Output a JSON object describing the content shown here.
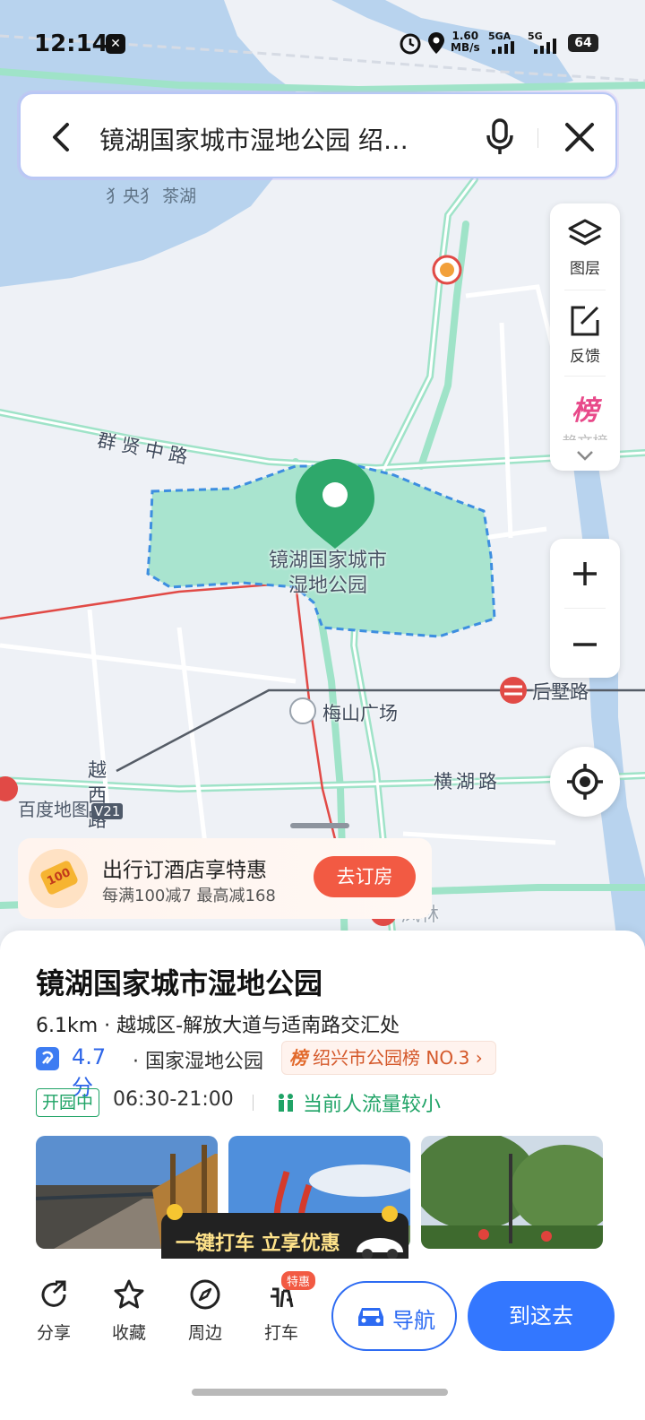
{
  "status_bar": {
    "time": "12:14",
    "speed": "1.60",
    "speed_unit": "MB/s",
    "sig1": "5GA",
    "sig2": "5G",
    "battery": "64"
  },
  "search": {
    "query": "镜湖国家城市湿地公园 绍…"
  },
  "map": {
    "labels": {
      "water": "茶湖",
      "water_partial": "犭央犭",
      "road_qunxian": "群贤中路",
      "park": [
        "镜湖国家城市",
        "湿地公园"
      ],
      "metro_meishan": "梅山广场",
      "metro_houshu": "后墅路",
      "road_henghu": "横湖路",
      "road_yuexi": [
        "越",
        "西",
        "路"
      ],
      "metro_fenglin": "凤林",
      "watermark": "百度地图",
      "watermark_version": "V21"
    }
  },
  "tools": {
    "layers": "图层",
    "feedback": "反馈",
    "rank_label": "榜",
    "rank_text": "趋文榜"
  },
  "promo": {
    "title": "出行订酒店享特惠",
    "subtitle": "每满100减7   最高减168",
    "button": "去订房",
    "icon_text": "100"
  },
  "place": {
    "name": "镜湖国家城市湿地公园",
    "address": "6.1km · 越城区-解放大道与适南路交汇处",
    "rating": "4.7分",
    "type": "· 国家湿地公园",
    "rank_prefix": "榜",
    "rank": "绍兴市公园榜 NO.3 ›",
    "open_status": "开园中",
    "hours": "06:30-21:00",
    "crowd": "当前人流量较小"
  },
  "taxi_promo": "一键打车 立享优惠",
  "actions": {
    "share": "分享",
    "favorite": "收藏",
    "nearby": "周边",
    "taxi": "打车",
    "taxi_badge": "特惠",
    "navigate": "导航",
    "go_here": "到这去"
  },
  "colors": {
    "accent_blue": "#3377ff",
    "park_green": "#a9e4cf",
    "pin_green": "#2ea86b",
    "promo_red": "#f25a43",
    "open_green": "#1fa366"
  }
}
